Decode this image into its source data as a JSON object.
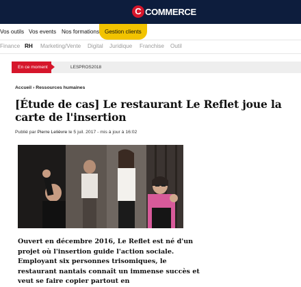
{
  "brand": {
    "logo_letter": "C",
    "logo_text": "COMMERCE"
  },
  "nav_primary": {
    "items": [
      {
        "label": "Vos outils"
      },
      {
        "label": "Vos events"
      },
      {
        "label": "Nos formations"
      },
      {
        "label": "Gestion clients"
      }
    ]
  },
  "nav_secondary": {
    "items": [
      {
        "label": "Finance"
      },
      {
        "label": "RH"
      },
      {
        "label": "Marketing/Vente"
      },
      {
        "label": "Digital"
      },
      {
        "label": "Juridique"
      },
      {
        "label": "Franchise"
      },
      {
        "label": "Outil"
      }
    ],
    "active": "RH"
  },
  "ticker": {
    "badge": "En ce moment",
    "tag": "LESPROS2018"
  },
  "breadcrumb": {
    "text": "Accueil › Ressources humaines"
  },
  "article": {
    "title": "[Étude de cas] Le restaurant Le Reflet joue la carte de l'insertion",
    "byline_prefix": "Publié par ",
    "author": "Pierre Lelièvre",
    "byline_suffix": " le 5 juil. 2017 - mis à jour à 16:02",
    "lead": "Ouvert en décembre 2016, Le Reflet est né d'un projet où l'insertion guide l'action sociale. Employant six personnes trisomiques, le restaurant nantais connaît un immense succès et veut se faire copier partout en"
  },
  "colors": {
    "topbar": "#0d1d3d",
    "brand_red": "#d6162b",
    "highlight_yellow": "#f2c300"
  }
}
